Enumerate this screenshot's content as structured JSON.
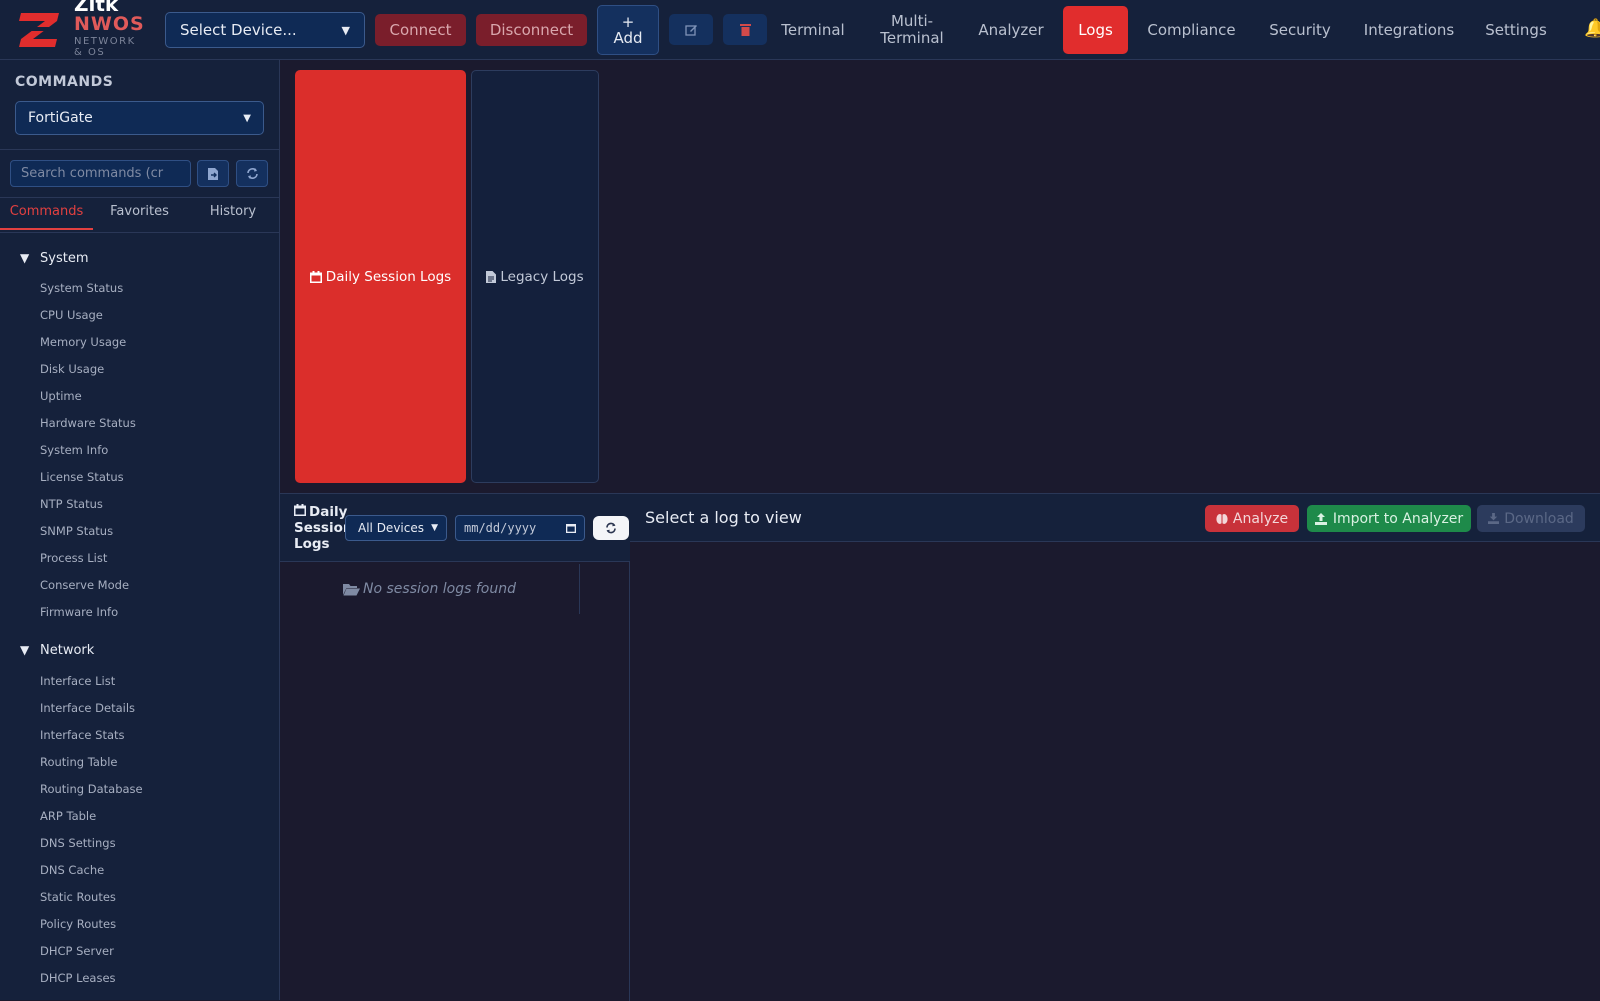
{
  "brand": {
    "name": "Zitk",
    "product": "NWOS",
    "tagline_line1": "NETWORK",
    "tagline_line2": "& OS",
    "accent": "#e12d2d"
  },
  "toolbar": {
    "device_select": "Select Device...",
    "connect_label": "Connect",
    "disconnect_label": "Disconnect",
    "add_label_line1": "+",
    "add_label_line2": "Add",
    "edit_icon": "edit-icon",
    "delete_icon": "trash-icon"
  },
  "nav": {
    "terminal": "Terminal",
    "multi_terminal_line1": "Multi-",
    "multi_terminal_line2": "Terminal",
    "analyzer": "Analyzer",
    "logs": "Logs",
    "compliance": "Compliance",
    "security": "Security",
    "integrations": "Integrations",
    "settings": "Settings",
    "active": "Logs"
  },
  "sidebar": {
    "heading": "COMMANDS",
    "vendor": "FortiGate",
    "search_placeholder": " Search commands (cr",
    "tabs": {
      "commands": "Commands",
      "favorites": "Favorites",
      "history": "History",
      "active": "Commands"
    },
    "categories": {
      "system": {
        "label": "System",
        "items": [
          "System Status",
          "CPU Usage",
          "Memory Usage",
          "Disk Usage",
          "Uptime",
          "Hardware Status",
          "System Info",
          "License Status",
          "NTP Status",
          "SNMP Status",
          "Process List",
          "Conserve Mode",
          "Firmware Info"
        ]
      },
      "network": {
        "label": "Network",
        "items": [
          "Interface List",
          "Interface Details",
          "Interface Stats",
          "Routing Table",
          "Routing Database",
          "ARP Table",
          "DNS Settings",
          "DNS Cache",
          "Static Routes",
          "Policy Routes",
          "DHCP Server",
          "DHCP Leases"
        ]
      }
    }
  },
  "log_types": {
    "daily": "Daily Session Logs",
    "legacy": "Legacy Logs"
  },
  "session_panel": {
    "title_line1": "Daily",
    "title_line2": "Session",
    "title_line3": "Logs",
    "device_filter": "All Devices",
    "date_placeholder": "mm/dd/yyyy",
    "empty": "No session logs found"
  },
  "viewer": {
    "title": "Select a log to view",
    "analyze": "Analyze",
    "import": "Import to Analyzer",
    "download": "Download"
  }
}
